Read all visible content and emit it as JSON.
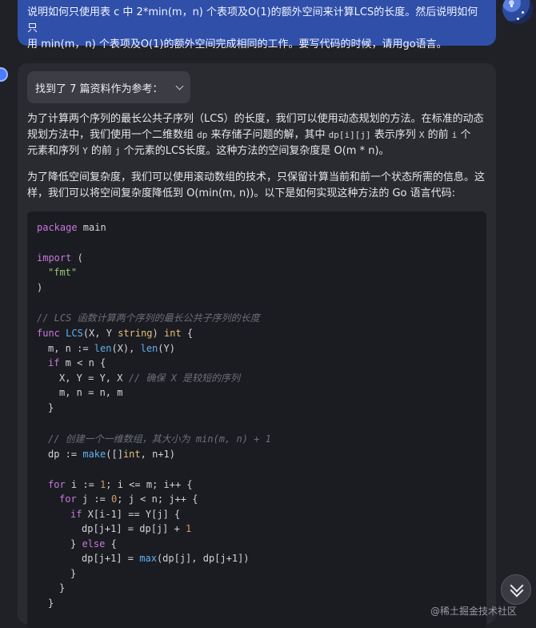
{
  "user_message": {
    "line1": "说明如何只使用表 c 中 2*min(m，n) 个表项及O(1)的额外空间来计算LCS的长度。然后说明如何只",
    "line2": "用 min(m，n) 个表项及O(1)的额外空间完成相同的工作。要写代码的时候，请用go语言。"
  },
  "references_button": {
    "label": "找到了 7 篇资料作为参考：",
    "icon": "chevron-down-icon"
  },
  "answer": {
    "p1": {
      "a": "为了计算两个序列的最长公共子序列（LCS）的长度，我们可以使用动态规划的方法。在标准的动态",
      "b1": "规划方法中，我们使用一个二维数组 ",
      "b_code1": "dp",
      "b2": " 来存储子问题的解，其中 ",
      "b_code2": "dp[i][j]",
      "b3": " 表示序列 ",
      "b_code3": "X",
      "b4": " 的前 ",
      "b_code4": "i",
      "b5": " 个",
      "c1": "元素和序列 ",
      "c_code1": "Y",
      "c2": " 的前 ",
      "c_code2": "j",
      "c3": " 个元素的LCS长度。这种方法的空间复杂度是 O(m * n)。"
    },
    "p2": {
      "a": "为了降低空间复杂度，我们可以使用滚动数组的技术，只保留计算当前和前一个状态所需的信息。这",
      "b": "样，我们可以将空间复杂度降低到 O(min(m, n))。以下是如何实现这种方法的 Go 语言代码:"
    }
  },
  "code": {
    "l1_kw": "package",
    "l1_rest": " main",
    "l3_kw": "import",
    "l3_rest": " (",
    "l4_str": "\"fmt\"",
    "l5": ")",
    "l7_cm": "// LCS 函数计算两个序列的最长公共子序列的长度",
    "l8_kw": "func",
    "l8_fn": "LCS",
    "l8_a": "(X, Y ",
    "l8_ty1": "string",
    "l8_b": ") ",
    "l8_ty2": "int",
    "l8_c": " {",
    "l9_a": "m, n := ",
    "l9_fn1": "len",
    "l9_b": "(X), ",
    "l9_fn2": "len",
    "l9_c": "(Y)",
    "l10_kw": "if",
    "l10_rest": " m < n {",
    "l11_a": "X, Y = Y, X ",
    "l11_cm": "// 确保 X 是较短的序列",
    "l12": "m, n = n, m",
    "l13": "}",
    "l15_cm": "// 创建一个一维数组，其大小为 min(m, n) + 1",
    "l16_a": "dp := ",
    "l16_fn": "make",
    "l16_b": "([]",
    "l16_ty": "int",
    "l16_c": ", n+1)",
    "l18_kw": "for",
    "l18_a": " i := ",
    "l18_num": "1",
    "l18_b": "; i <= m; i++ {",
    "l19_kw": "for",
    "l19_a": " j := ",
    "l19_num": "0",
    "l19_b": "; j < n; j++ {",
    "l20_kw": "if",
    "l20_rest": " X[i-1] == Y[j] {",
    "l21_a": "dp[j+1] = dp[j] + ",
    "l21_num": "1",
    "l22_a": "} ",
    "l22_kw": "else",
    "l22_b": " {",
    "l23_a": "dp[j+1] = ",
    "l23_fn": "max",
    "l23_b": "(dp[j], dp[j+1])",
    "l24": "}",
    "l25": "}",
    "l26": "}"
  },
  "scroll_button": {
    "icon": "double-chevron-down-icon"
  },
  "watermark": "@稀土掘金技术社区"
}
